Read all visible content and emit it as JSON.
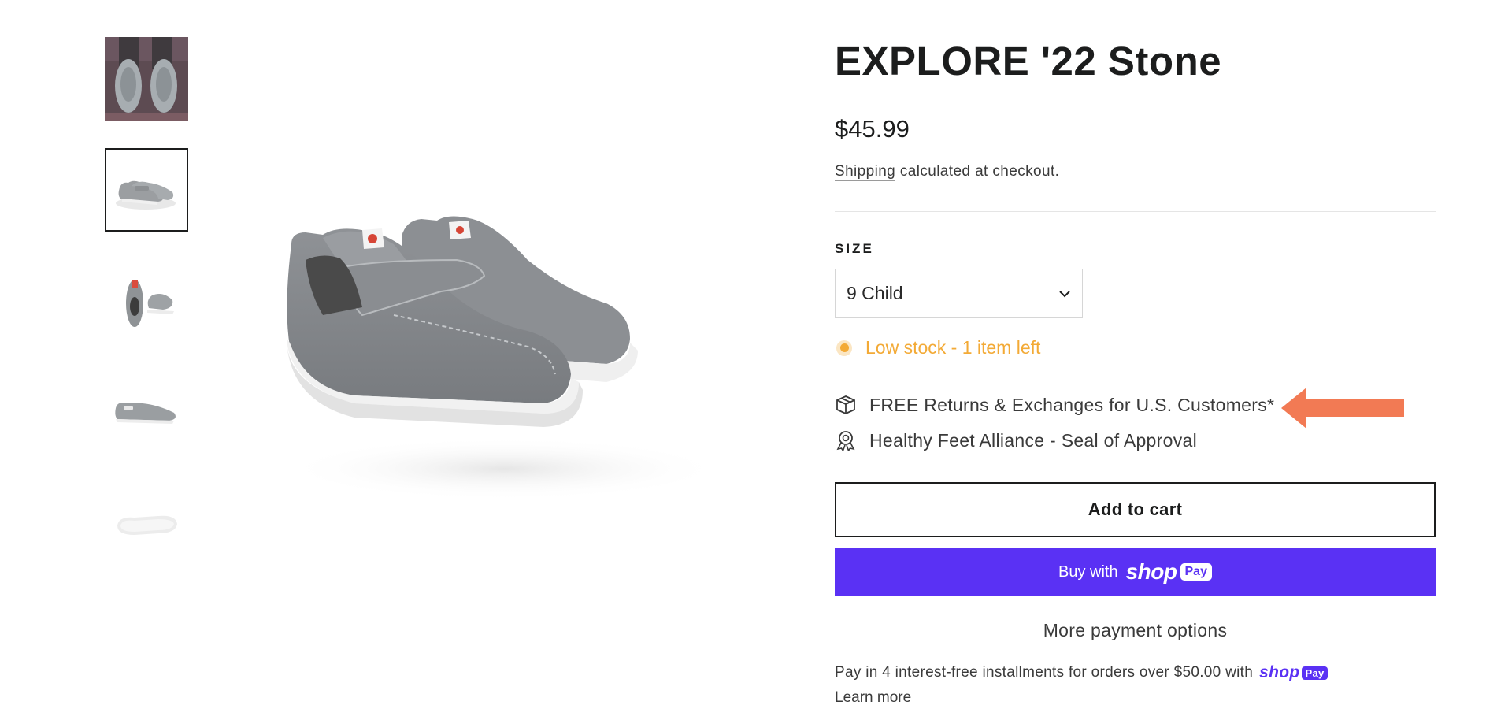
{
  "gallery": {
    "thumbnails": [
      {
        "icon": "shoe-on-feet-photo",
        "active": false
      },
      {
        "icon": "shoe-pair-side-photo",
        "active": true
      },
      {
        "icon": "shoe-top-view-photo",
        "active": false
      },
      {
        "icon": "shoe-side-view-photo",
        "active": false
      },
      {
        "icon": "shoe-sole-photo",
        "active": false
      }
    ],
    "main_image_icon": "shoe-pair-main-photo"
  },
  "product": {
    "title": "EXPLORE '22 Stone",
    "price": "$45.99",
    "shipping_link": "Shipping",
    "shipping_text": " calculated at checkout.",
    "size_label": "SIZE",
    "size_value": "9 Child",
    "stock_text": "Low stock - 1 item left",
    "perks": [
      {
        "icon": "box-icon",
        "text": "FREE Returns & Exchanges for U.S. Customers*"
      },
      {
        "icon": "award-icon",
        "text": "Healthy Feet Alliance - Seal of Approval"
      }
    ],
    "add_to_cart": "Add to cart",
    "buy_with": "Buy with",
    "shop_word": "shop",
    "pay_badge": "Pay",
    "more_payment": "More payment options",
    "installments_text": "Pay in 4 interest-free installments for orders over $50.00 with",
    "learn_more": "Learn more"
  },
  "colors": {
    "accent": "#5a31f4",
    "stock": "#f3aa36",
    "arrow": "#f27a54",
    "text": "#1c1d1d"
  }
}
